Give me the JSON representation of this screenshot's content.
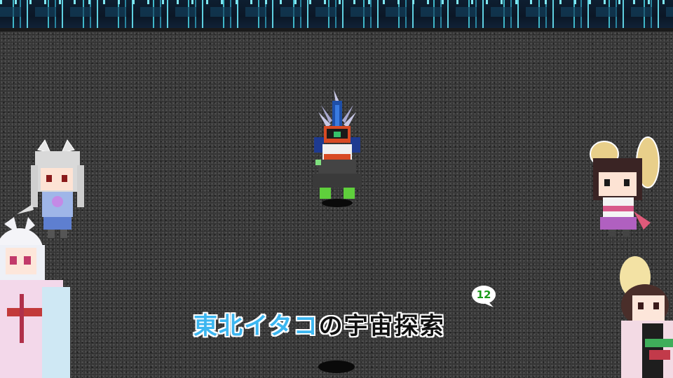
{
  "game": {
    "title_blue": "東北イタコ",
    "title_white": "の宇宙探索",
    "episode_number": "12"
  },
  "colors": {
    "title_accent": "#3cb6f0",
    "episode_number": "#1a9a1a",
    "wall": "#0d1e30",
    "floor": "#303030"
  },
  "sprites": {
    "hero": "blue-crested-armored-knight",
    "left_npc": "white-fox-girl",
    "right_npc": "dark-haired-fox-girl",
    "portrait_left": "white-haired-kimono-girl",
    "portrait_right": "brown-haired-kimono-girl"
  }
}
